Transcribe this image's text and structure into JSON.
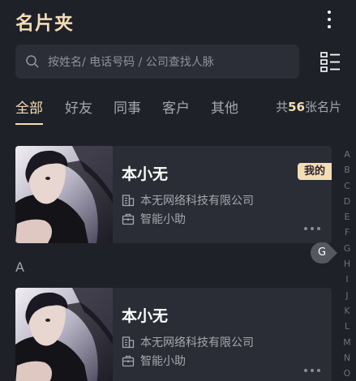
{
  "header": {
    "title": "名片夹",
    "more_icon": "more-vertical-icon"
  },
  "search": {
    "placeholder": "按姓名/ 电话号码 / 公司查找人脉",
    "icon": "search-icon"
  },
  "view_toggle_icon": "list-view-icon",
  "tabs": [
    {
      "label": "全部",
      "active": true
    },
    {
      "label": "好友",
      "active": false
    },
    {
      "label": "同事",
      "active": false
    },
    {
      "label": "客户",
      "active": false
    },
    {
      "label": "其他",
      "active": false
    }
  ],
  "count": {
    "prefix": "共",
    "number": "56",
    "suffix": "张名片"
  },
  "cards": [
    {
      "name": "本小无",
      "company": "本无网络科技有限公司",
      "position": "智能小助",
      "badge": "我的"
    },
    {
      "name": "本小无",
      "company": "本无网络科技有限公司",
      "position": "智能小助",
      "badge": ""
    }
  ],
  "section_header": "A",
  "index": {
    "letters": [
      "A",
      "B",
      "C",
      "D",
      "E",
      "F",
      "G",
      "H",
      "I",
      "J",
      "K",
      "L",
      "M",
      "N",
      "O"
    ],
    "highlighted": "G"
  },
  "colors": {
    "accent": "#f3ddb5",
    "background": "#1f2129",
    "card": "#2b2d36",
    "secondary_text": "#a4a7ae"
  }
}
